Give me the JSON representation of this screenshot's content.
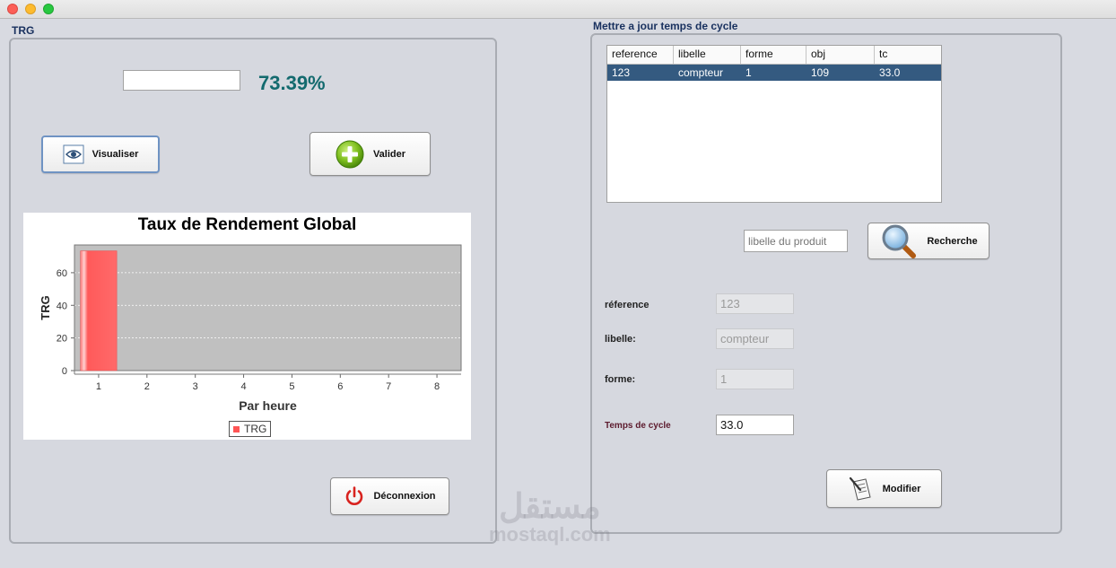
{
  "window": {
    "trg_section_title": "TRG",
    "cycle_section_title": "Mettre a jour temps de cycle"
  },
  "trg_panel": {
    "input_value": "",
    "value_display": "73.39%",
    "visualiser_label": "Visualiser",
    "valider_label": "Valider",
    "deconnexion_label": "Déconnexion"
  },
  "chart_data": {
    "type": "bar",
    "title": "Taux de Rendement Global",
    "xlabel": "Par heure",
    "ylabel": "TRG",
    "categories": [
      "1",
      "2",
      "3",
      "4",
      "5",
      "6",
      "7",
      "8"
    ],
    "series": [
      {
        "name": "TRG",
        "values": [
          73.39,
          0,
          0,
          0,
          0,
          0,
          0,
          0
        ]
      }
    ],
    "yticks": [
      "0",
      "20",
      "40",
      "60"
    ],
    "ylim": [
      0,
      77
    ],
    "xlim": [
      0.5,
      8.5
    ],
    "grid": true,
    "legend_position": "bottom",
    "colors": {
      "bar": "#ff5a5a",
      "plot_bg": "#c0c0c0"
    }
  },
  "table": {
    "columns": [
      "reference",
      "libelle",
      "forme",
      "obj",
      "tc"
    ],
    "rows": [
      [
        "123",
        "compteur",
        "1",
        "109",
        "33.0"
      ]
    ]
  },
  "search": {
    "placeholder": "libelle du produit",
    "button_label": "Recherche"
  },
  "form": {
    "reference_label": "réference",
    "reference_value": "123",
    "libelle_label": "libelle:",
    "libelle_value": "compteur",
    "forme_label": "forme:",
    "forme_value": "1",
    "tc_label": "Temps de cycle",
    "tc_value": "33.0",
    "modifier_label": "Modifier"
  },
  "watermark": {
    "arabic": "مستقل",
    "latin": "mostaql.com"
  },
  "colors": {
    "accent": "#136a6e",
    "selection": "#345a80",
    "section_title": "#18305e"
  }
}
